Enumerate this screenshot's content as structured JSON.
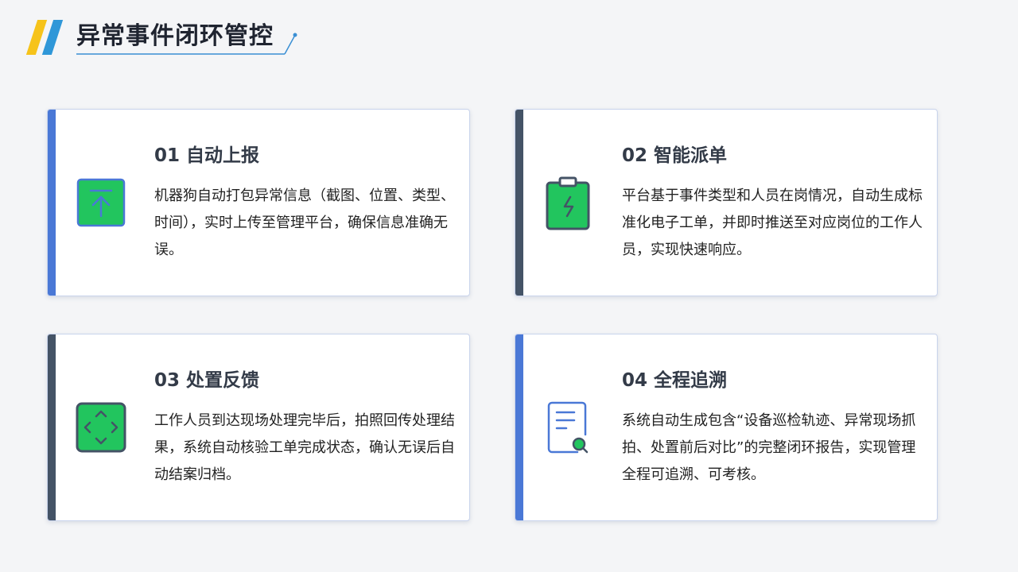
{
  "header": {
    "title": "异常事件闭环管控"
  },
  "colors": {
    "accent_blue": "#4a78d6",
    "accent_slate": "#445366",
    "icon_green": "#22c55e",
    "stripe_yellow": "#f6c31a",
    "stripe_blue": "#2f97d8"
  },
  "cards": [
    {
      "title": "01 自动上报",
      "icon": "upload-icon",
      "description": "机器狗自动打包异常信息（截图、位置、类型、时间），实时上传至管理平台，确保信息准确无误。"
    },
    {
      "title": "02 智能派单",
      "icon": "clipboard-lightning-icon",
      "description": "平台基于事件类型和人员在岗情况，自动生成标准化电子工单，并即时推送至对应岗位的工作人员，实现快速响应。"
    },
    {
      "title": "03 处置反馈",
      "icon": "expand-arrows-icon",
      "description": "工作人员到达现场处理完毕后，拍照回传处理结果，系统自动核验工单完成状态，确认无误后自动结案归档。"
    },
    {
      "title": "04 全程追溯",
      "icon": "document-search-icon",
      "description": "系统自动生成包含“设备巡检轨迹、异常现场抓拍、处置前后对比”的完整闭环报告，实现管理全程可追溯、可考核。"
    }
  ]
}
